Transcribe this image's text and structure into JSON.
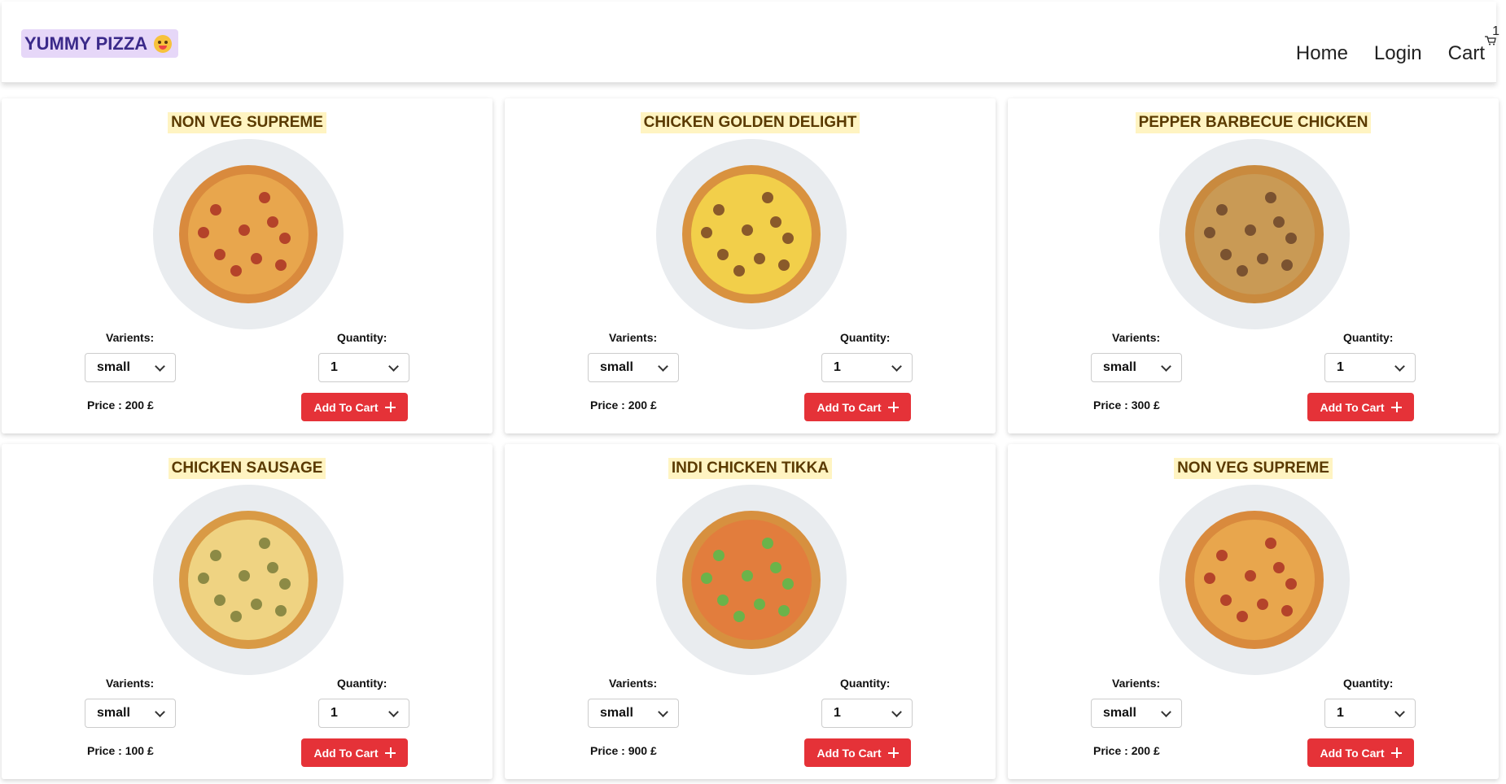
{
  "navbar": {
    "brand": "YUMMY PIZZA",
    "links": {
      "home": "Home",
      "login": "Login",
      "cart": "Cart"
    },
    "cart_count": "1"
  },
  "labels": {
    "variants": "Varients:",
    "quantity": "Quantity:",
    "add_to_cart": "Add To Cart"
  },
  "pizzas": [
    {
      "name": "NON VEG SUPREME",
      "variant": "small",
      "quantity": "1",
      "price": "Price : 200 £",
      "colors": {
        "crust": "#d98a3d",
        "cheese": "#e8a64d",
        "topping": "#b4432a"
      }
    },
    {
      "name": "CHICKEN GOLDEN DELIGHT",
      "variant": "small",
      "quantity": "1",
      "price": "Price : 200 £",
      "colors": {
        "crust": "#d9923f",
        "cheese": "#f2cf4a",
        "topping": "#8a5a2a"
      }
    },
    {
      "name": "PEPPER BARBECUE CHICKEN",
      "variant": "small",
      "quantity": "1",
      "price": "Price : 300 £",
      "colors": {
        "crust": "#c98a3e",
        "cheese": "#c99a55",
        "topping": "#7a5230"
      }
    },
    {
      "name": "CHICKEN SAUSAGE",
      "variant": "small",
      "quantity": "1",
      "price": "Price : 100 £",
      "colors": {
        "crust": "#d99a45",
        "cheese": "#efd382",
        "topping": "#8c8a45"
      }
    },
    {
      "name": "INDI CHICKEN TIKKA",
      "variant": "small",
      "quantity": "1",
      "price": "Price : 900 £",
      "colors": {
        "crust": "#d7903f",
        "cheese": "#e27d3d",
        "topping": "#6bb34a"
      }
    },
    {
      "name": "NON VEG SUPREME",
      "variant": "small",
      "quantity": "1",
      "price": "Price : 200 £",
      "colors": {
        "crust": "#d98a3d",
        "cheese": "#e8a64d",
        "topping": "#b4432a"
      }
    }
  ]
}
